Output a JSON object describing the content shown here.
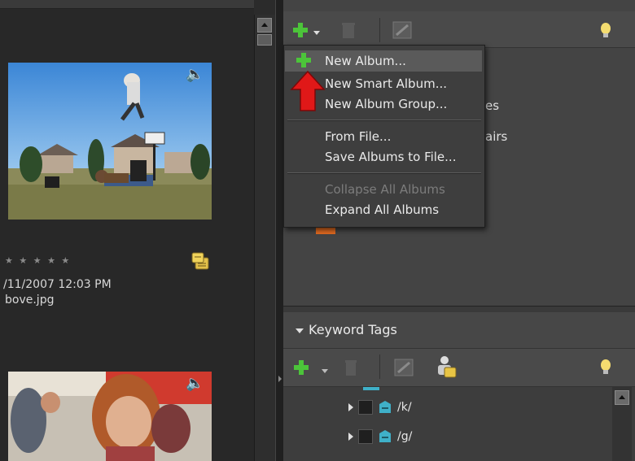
{
  "left": {
    "photo1": {
      "stars": "★ ★ ★ ★ ★",
      "date": "/11/2007 12:03 PM",
      "filename": "bove.jpg"
    }
  },
  "albums_panel": {
    "menu": {
      "items": [
        {
          "label": "New Album...",
          "enabled": true
        },
        {
          "label": "New Smart Album...",
          "enabled": true
        },
        {
          "label": "New Album Group...",
          "enabled": true
        },
        {
          "label": "From File...",
          "enabled": true
        },
        {
          "label": "Save Albums to File...",
          "enabled": true
        },
        {
          "label": "Collapse All Albums",
          "enabled": false
        },
        {
          "label": "Expand All Albums",
          "enabled": true
        }
      ]
    },
    "tree_partial": {
      "item_es": "es",
      "item_airs": "airs"
    }
  },
  "keyword_panel": {
    "title": "Keyword Tags",
    "tags": [
      {
        "label": "/k/"
      },
      {
        "label": "/g/"
      }
    ]
  },
  "colors": {
    "accent_green": "#4cc43a",
    "arrow_red": "#e01818",
    "tag_teal": "#3fb0c8"
  }
}
